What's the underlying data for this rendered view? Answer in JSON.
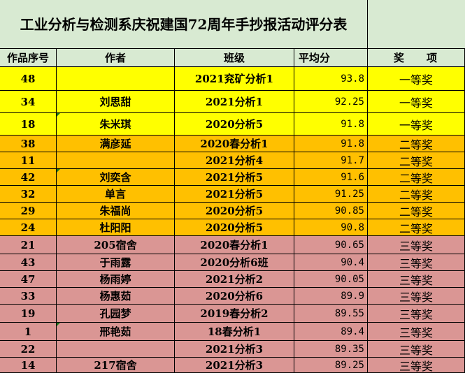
{
  "title": "工业分析与检测系庆祝建国72周年手抄报活动评分表",
  "headers": {
    "id": "作品序号",
    "author": "作者",
    "class": "班级",
    "score": "平均分",
    "award_a": "奖",
    "award_b": "项"
  },
  "colors": {
    "header_bg": "#d8ead2",
    "first_prize_bg": "#ffff00",
    "second_prize_bg": "#ffc000",
    "third_prize_bg": "#da9694",
    "comment_marker": "#1a7a1a"
  },
  "rows": [
    {
      "id": "48",
      "author": "",
      "class": "2021兖矿分析1",
      "score": "93.8",
      "award": "一等奖",
      "tier": "first",
      "marker": false
    },
    {
      "id": "34",
      "author": "刘思甜",
      "class": "2021分析1",
      "score": "92.25",
      "award": "一等奖",
      "tier": "first",
      "marker": false
    },
    {
      "id": "18",
      "author": "朱米琪",
      "class": "2020分析5",
      "score": "91.8",
      "award": "一等奖",
      "tier": "first",
      "marker": true
    },
    {
      "id": "38",
      "author": "满彦延",
      "class": "2020春分析1",
      "score": "91.8",
      "award": "二等奖",
      "tier": "second",
      "marker": false
    },
    {
      "id": "11",
      "author": "",
      "class": "2021分析4",
      "score": "91.7",
      "award": "二等奖",
      "tier": "second",
      "marker": false
    },
    {
      "id": "42",
      "author": "刘奕含",
      "class": "2021分析5",
      "score": "91.6",
      "award": "二等奖",
      "tier": "second",
      "marker": true
    },
    {
      "id": "32",
      "author": "单言",
      "class": "2021分析5",
      "score": "91.25",
      "award": "二等奖",
      "tier": "second",
      "marker": false
    },
    {
      "id": "29",
      "author": "朱福尚",
      "class": "2020分析5",
      "score": "90.85",
      "award": "二等奖",
      "tier": "second",
      "marker": false
    },
    {
      "id": "24",
      "author": "杜阳阳",
      "class": "2020分析5",
      "score": "90.8",
      "award": "二等奖",
      "tier": "second",
      "marker": false
    },
    {
      "id": "21",
      "author": "205宿舍",
      "class": "2020春分析1",
      "score": "90.65",
      "award": "三等奖",
      "tier": "third",
      "marker": false
    },
    {
      "id": "43",
      "author": "于雨露",
      "class": "2020分析6班",
      "score": "90.4",
      "award": "三等奖",
      "tier": "third",
      "marker": false
    },
    {
      "id": "47",
      "author": "杨雨婷",
      "class": "2021分析2",
      "score": "90.05",
      "award": "三等奖",
      "tier": "third",
      "marker": false
    },
    {
      "id": "33",
      "author": "杨惠茹",
      "class": "2020分析6",
      "score": "89.9",
      "award": "三等奖",
      "tier": "third",
      "marker": false
    },
    {
      "id": "19",
      "author": "孔园梦",
      "class": "2019春分析2",
      "score": "89.55",
      "award": "三等奖",
      "tier": "third",
      "marker": false
    },
    {
      "id": "1",
      "author": "邢艳茹",
      "class": "18春分析1",
      "score": "89.4",
      "award": "三等奖",
      "tier": "third",
      "marker": true
    },
    {
      "id": "22",
      "author": "",
      "class": "2021分析3",
      "score": "89.35",
      "award": "三等奖",
      "tier": "third",
      "marker": false
    },
    {
      "id": "14",
      "author": "217宿舍",
      "class": "2021分析3",
      "score": "89.25",
      "award": "三等奖",
      "tier": "third",
      "marker": false
    }
  ]
}
